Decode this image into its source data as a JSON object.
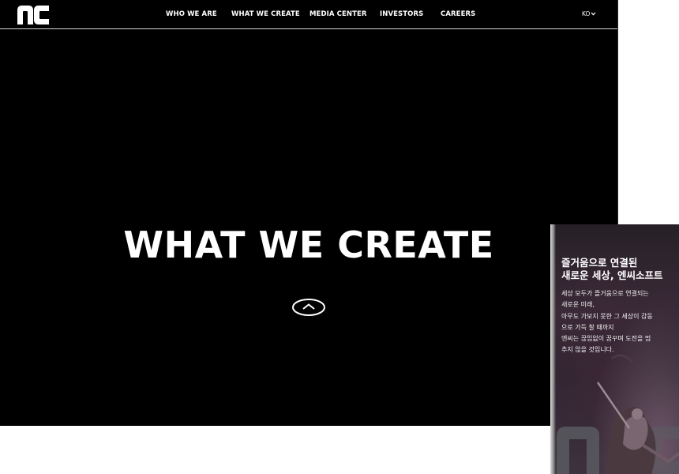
{
  "header": {
    "logo_text": "nc",
    "nav": [
      {
        "label": "WHO WE ARE"
      },
      {
        "label": "WHAT WE CREATE"
      },
      {
        "label": "MEDIA CENTER"
      },
      {
        "label": "INVESTORS"
      },
      {
        "label": "CAREERS"
      }
    ],
    "language": "KO"
  },
  "hero": {
    "title": "WHAT WE CREATE"
  },
  "card": {
    "heading": [
      "즐거움으로 연결된",
      "새로운 세상, 엔씨소프트"
    ],
    "body": [
      "세상 모두가 즐거움으로 연결되는",
      "새로운 미래,",
      "아무도 가보지 못한 그 세상이 감동",
      "으로 가득 찰 때까지",
      "엔씨는 끊임없이 꿈꾸며 도전을 멈",
      "추지 않을 것입니다."
    ]
  },
  "colors": {
    "background": "#000000",
    "text": "#ffffff",
    "divider": "#d9d9d9"
  }
}
